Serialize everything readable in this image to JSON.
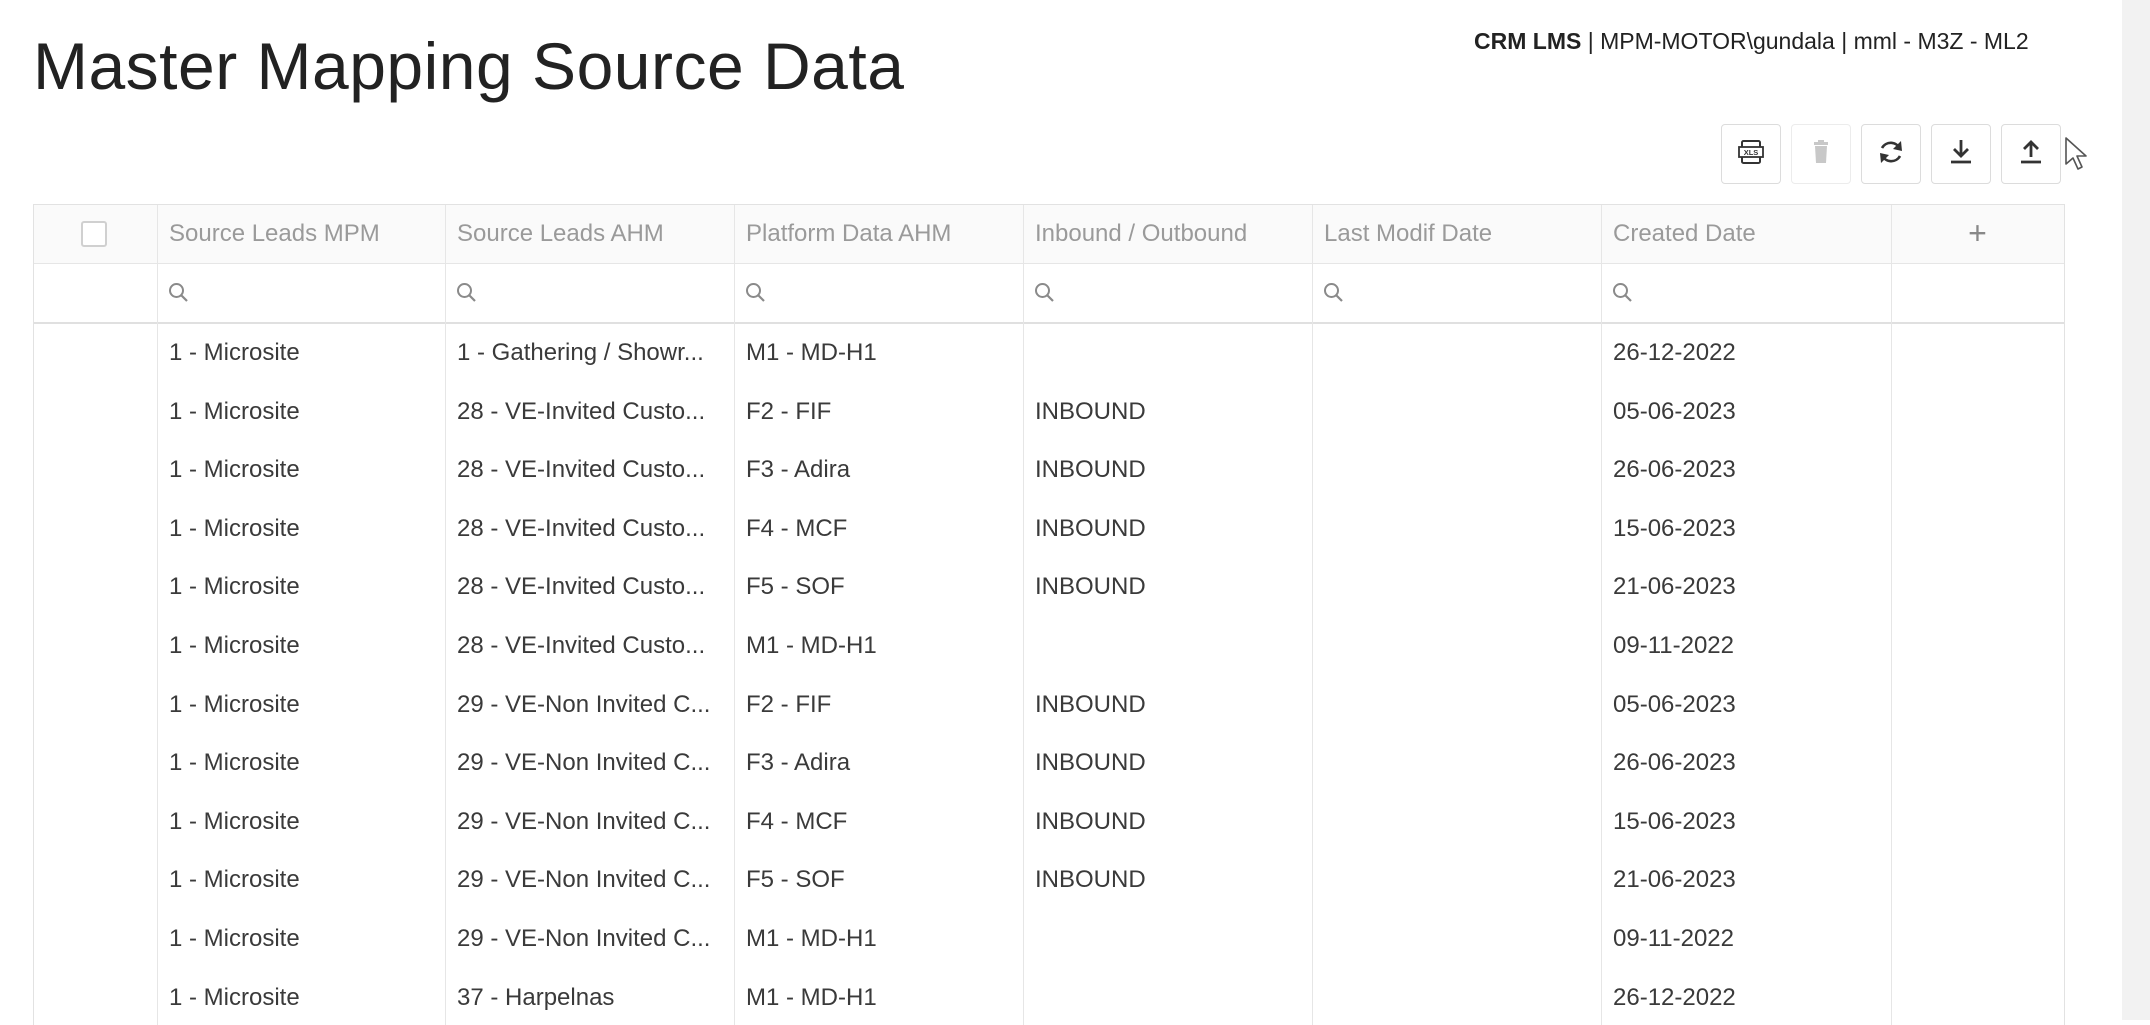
{
  "page": {
    "title": "Master Mapping Source Data"
  },
  "app_info": {
    "app_name": "CRM LMS",
    "context": " | MPM-MOTOR\\gundala | mml - M3Z - ML2"
  },
  "toolbar": {
    "buttons": [
      {
        "name": "export-xls",
        "icon": "xls-icon",
        "enabled": true
      },
      {
        "name": "delete",
        "icon": "trash-icon",
        "enabled": false
      },
      {
        "name": "refresh",
        "icon": "refresh-icon",
        "enabled": true
      },
      {
        "name": "download",
        "icon": "download-icon",
        "enabled": true
      },
      {
        "name": "upload",
        "icon": "upload-icon",
        "enabled": true
      }
    ]
  },
  "table": {
    "columns": [
      "Source Leads MPM",
      "Source Leads AHM",
      "Platform Data AHM",
      "Inbound / Outbound",
      "Last Modif Date",
      "Created Date"
    ],
    "add_column_label": "+",
    "rows": [
      [
        "1 - Microsite",
        "1 - Gathering / Showr...",
        "M1 - MD-H1",
        "",
        "",
        "26-12-2022"
      ],
      [
        "1 - Microsite",
        "28 - VE-Invited Custo...",
        "F2 - FIF",
        "INBOUND",
        "",
        "05-06-2023"
      ],
      [
        "1 - Microsite",
        "28 - VE-Invited Custo...",
        "F3 - Adira",
        "INBOUND",
        "",
        "26-06-2023"
      ],
      [
        "1 - Microsite",
        "28 - VE-Invited Custo...",
        "F4 - MCF",
        "INBOUND",
        "",
        "15-06-2023"
      ],
      [
        "1 - Microsite",
        "28 - VE-Invited Custo...",
        "F5 - SOF",
        "INBOUND",
        "",
        "21-06-2023"
      ],
      [
        "1 - Microsite",
        "28 - VE-Invited Custo...",
        "M1 - MD-H1",
        "",
        "",
        "09-11-2022"
      ],
      [
        "1 - Microsite",
        "29 - VE-Non Invited C...",
        "F2 - FIF",
        "INBOUND",
        "",
        "05-06-2023"
      ],
      [
        "1 - Microsite",
        "29 - VE-Non Invited C...",
        "F3 - Adira",
        "INBOUND",
        "",
        "26-06-2023"
      ],
      [
        "1 - Microsite",
        "29 - VE-Non Invited C...",
        "F4 - MCF",
        "INBOUND",
        "",
        "15-06-2023"
      ],
      [
        "1 - Microsite",
        "29 - VE-Non Invited C...",
        "F5 - SOF",
        "INBOUND",
        "",
        "21-06-2023"
      ],
      [
        "1 - Microsite",
        "29 - VE-Non Invited C...",
        "M1 - MD-H1",
        "",
        "",
        "09-11-2022"
      ],
      [
        "1 - Microsite",
        "37 - Harpelnas",
        "M1 - MD-H1",
        "",
        "",
        "26-12-2022"
      ]
    ]
  },
  "colors": {
    "border": "#e6e6e6",
    "header_text": "#9a9a9a",
    "icon": "#333333",
    "disabled_icon": "#c8c8c8"
  }
}
